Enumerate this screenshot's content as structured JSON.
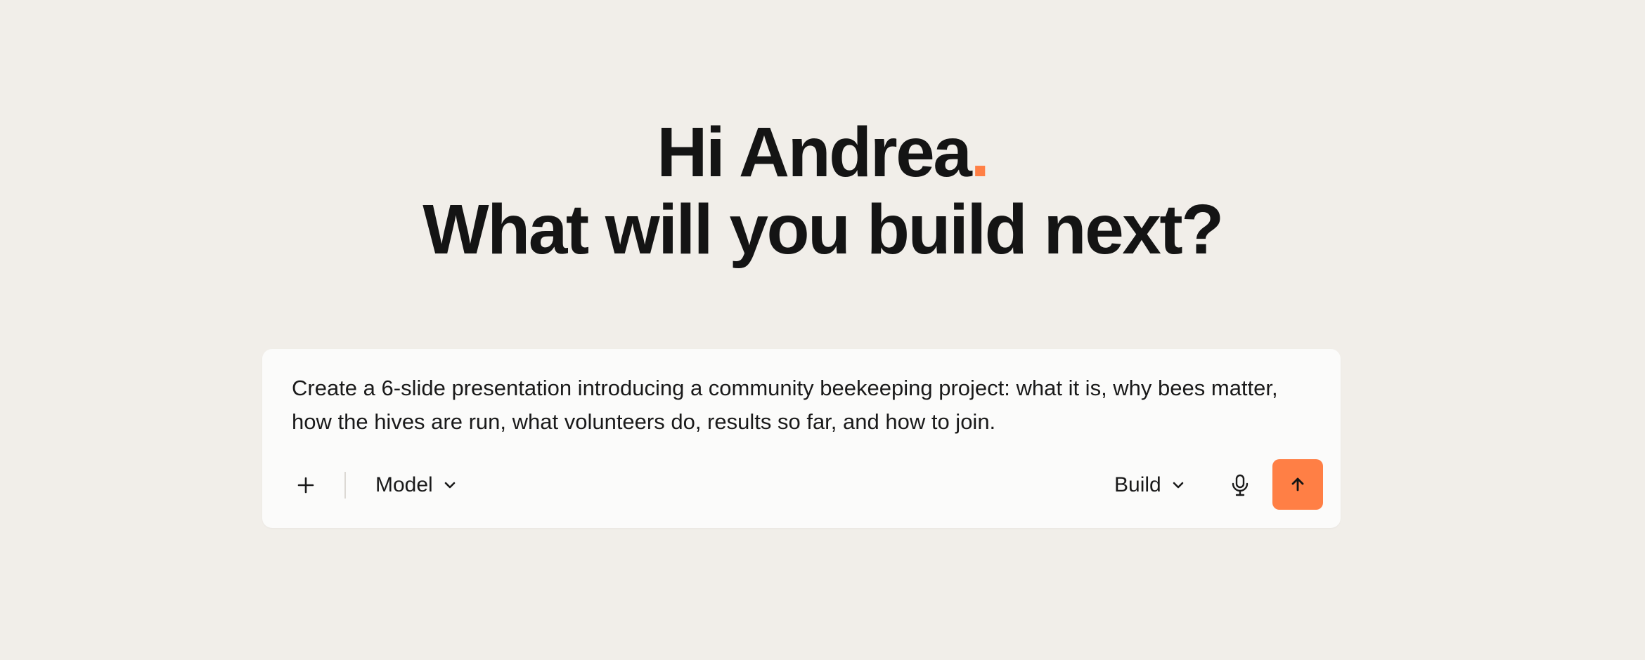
{
  "greeting": {
    "line1": "Hi Andrea",
    "line1_punct": ".",
    "line2": "What will you build next?"
  },
  "composer": {
    "prompt_text": "Create a 6-slide presentation introducing a community beekeeping project: what it is, why bees matter, how the hives are run, what volunteers do, results so far, and how to join.",
    "model_label": "Model",
    "mode_label": "Build"
  },
  "icons": {
    "attach": "plus-icon",
    "model_dropdown": "chevron-down-icon",
    "mode_dropdown": "chevron-down-icon",
    "voice": "microphone-icon",
    "send": "arrow-up-icon"
  },
  "colors": {
    "background": "#f1eee9",
    "accent": "#ff7f45",
    "text": "#141414",
    "composer_bg": "#fbfbfa"
  }
}
